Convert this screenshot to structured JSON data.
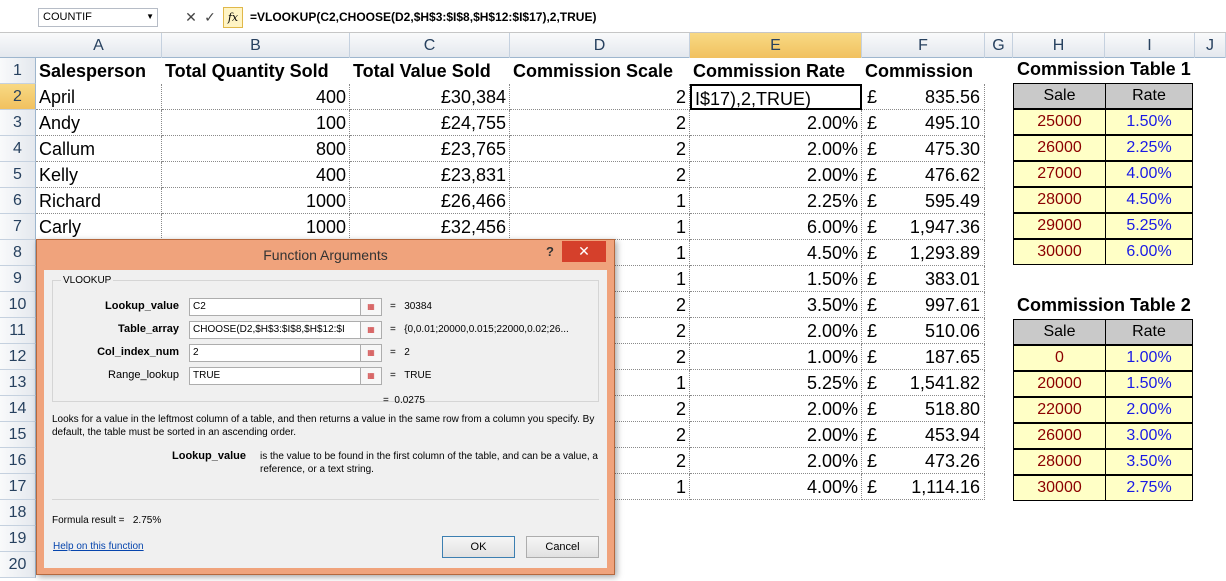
{
  "formula_bar": {
    "name_box": "COUNTIF",
    "fx_label": "fx",
    "cancel_glyph": "✕",
    "enter_glyph": "✓",
    "formula": "=VLOOKUP(C2,CHOOSE(D2,$H$3:$I$8,$H$12:$I$17),2,TRUE)"
  },
  "columns": [
    "A",
    "B",
    "C",
    "D",
    "E",
    "F",
    "G",
    "H",
    "I",
    "J"
  ],
  "rows": [
    "1",
    "2",
    "3",
    "4",
    "5",
    "6",
    "7",
    "8",
    "9",
    "10",
    "11",
    "12",
    "13",
    "14",
    "15",
    "16",
    "17",
    "18",
    "19",
    "20"
  ],
  "headers": {
    "a": "Salesperson",
    "b": "Total Quantity Sold",
    "c": "Total Value Sold",
    "d": "Commission Scale",
    "e": "Commission Rate",
    "f": "Commission"
  },
  "data_rows": [
    {
      "a": "April",
      "b": "400",
      "c": "£30,384",
      "d": "2",
      "e": "I$17),2,TRUE)",
      "f": "835.56"
    },
    {
      "a": "Andy",
      "b": "100",
      "c": "£24,755",
      "d": "2",
      "e": "2.00%",
      "f": "495.10"
    },
    {
      "a": "Callum",
      "b": "800",
      "c": "£23,765",
      "d": "2",
      "e": "2.00%",
      "f": "475.30"
    },
    {
      "a": "Kelly",
      "b": "400",
      "c": "£23,831",
      "d": "2",
      "e": "2.00%",
      "f": "476.62"
    },
    {
      "a": "Richard",
      "b": "1000",
      "c": "£26,466",
      "d": "1",
      "e": "2.25%",
      "f": "595.49"
    },
    {
      "a": "Carly",
      "b": "1000",
      "c": "£32,456",
      "d": "1",
      "e": "6.00%",
      "f": "1,947.36"
    },
    {
      "a": "",
      "b": "",
      "c": "",
      "d": "1",
      "e": "4.50%",
      "f": "1,293.89"
    },
    {
      "a": "",
      "b": "",
      "c": "",
      "d": "1",
      "e": "1.50%",
      "f": "383.01"
    },
    {
      "a": "",
      "b": "",
      "c": "",
      "d": "2",
      "e": "3.50%",
      "f": "997.61"
    },
    {
      "a": "",
      "b": "",
      "c": "",
      "d": "2",
      "e": "2.00%",
      "f": "510.06"
    },
    {
      "a": "",
      "b": "",
      "c": "",
      "d": "2",
      "e": "1.00%",
      "f": "187.65"
    },
    {
      "a": "",
      "b": "",
      "c": "",
      "d": "1",
      "e": "5.25%",
      "f": "1,541.82"
    },
    {
      "a": "",
      "b": "",
      "c": "",
      "d": "2",
      "e": "2.00%",
      "f": "518.80"
    },
    {
      "a": "",
      "b": "",
      "c": "",
      "d": "2",
      "e": "2.00%",
      "f": "453.94"
    },
    {
      "a": "",
      "b": "",
      "c": "",
      "d": "2",
      "e": "2.00%",
      "f": "473.26"
    },
    {
      "a": "",
      "b": "",
      "c": "",
      "d": "1",
      "e": "4.00%",
      "f": "1,114.16"
    }
  ],
  "currency_symbol": "£",
  "table1": {
    "title": "Commission Table 1",
    "col_sale": "Sale",
    "col_rate": "Rate",
    "rows": [
      {
        "sale": "25000",
        "rate": "1.50%"
      },
      {
        "sale": "26000",
        "rate": "2.25%"
      },
      {
        "sale": "27000",
        "rate": "4.00%"
      },
      {
        "sale": "28000",
        "rate": "4.50%"
      },
      {
        "sale": "29000",
        "rate": "5.25%"
      },
      {
        "sale": "30000",
        "rate": "6.00%"
      }
    ]
  },
  "table2": {
    "title": "Commission Table 2",
    "col_sale": "Sale",
    "col_rate": "Rate",
    "rows": [
      {
        "sale": "0",
        "rate": "1.00%"
      },
      {
        "sale": "20000",
        "rate": "1.50%"
      },
      {
        "sale": "22000",
        "rate": "2.00%"
      },
      {
        "sale": "26000",
        "rate": "3.00%"
      },
      {
        "sale": "28000",
        "rate": "3.50%"
      },
      {
        "sale": "30000",
        "rate": "2.75%"
      }
    ]
  },
  "dialog": {
    "title": "Function Arguments",
    "help_glyph": "?",
    "close_glyph": "✕",
    "group": "VLOOKUP",
    "args": [
      {
        "label": "Lookup_value",
        "value": "C2",
        "result": "30384"
      },
      {
        "label": "Table_array",
        "value": "CHOOSE(D2,$H$3:$I$8,$H$12:$I",
        "result": "{0,0.01;20000,0.015;22000,0.02;26..."
      },
      {
        "label": "Col_index_num",
        "value": "2",
        "result": "2"
      },
      {
        "label": "Range_lookup",
        "value": "TRUE",
        "result": "TRUE"
      }
    ],
    "eq": "=",
    "overall_result": "0.0275",
    "description": "Looks for a value in the leftmost column of a table, and then returns a value in the same row from a column you specify. By default, the table must be sorted in an ascending order.",
    "arg_name": "Lookup_value",
    "arg_description": "is the value to be found in the first column of the table, and can be a value, a reference, or a text string.",
    "formula_result_label": "Formula result =",
    "formula_result_value": "2.75%",
    "help_link": "Help on this function",
    "ok": "OK",
    "cancel": "Cancel"
  }
}
